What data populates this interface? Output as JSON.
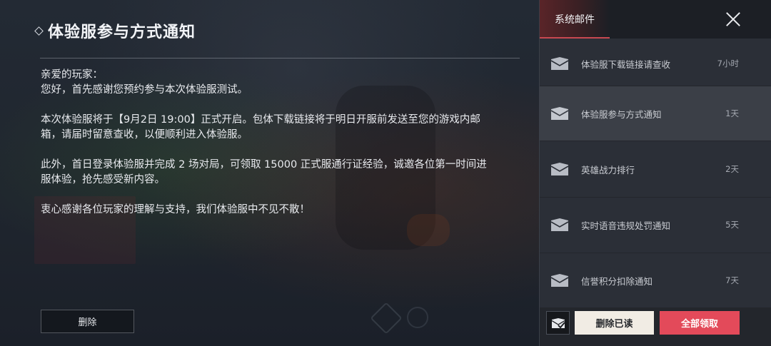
{
  "detail": {
    "title": "体验服参与方式通知",
    "greeting": "亲爱的玩家：",
    "line1": "您好，首先感谢您预约参与本次体验服测试。",
    "para2_line1": "本次体验服将于【9月2日 19:00】正式开启。包体下载链接将于明日开服前发送至您的游戏内邮",
    "para2_line2": "箱，请届时留意查收，以便顺利进入体验服。",
    "para3_line1": "此外，首日登录体验服并完成 2 场对局，可领取 15000 正式服通行证经验，诚邀各位第一时间进",
    "para3_line2": "服体验，抢先感受新内容。",
    "para4": "衷心感谢各位玩家的理解与支持，我们体验服中不见不散！",
    "delete_label": "删除"
  },
  "panel": {
    "tab_label": "系统邮件",
    "accent_color": "#c84850",
    "mails": [
      {
        "subject": "体验服下载链接请查收",
        "time": "7小时",
        "icon": "envelope-icon",
        "selected": false
      },
      {
        "subject": "体验服参与方式通知",
        "time": "1天",
        "icon": "envelope-icon",
        "selected": true
      },
      {
        "subject": "英雄战力排行",
        "time": "2天",
        "icon": "envelope-icon",
        "selected": false
      },
      {
        "subject": "实时语音违规处罚通知",
        "time": "5天",
        "icon": "envelope-icon",
        "selected": false
      },
      {
        "subject": "信誉积分扣除通知",
        "time": "7天",
        "icon": "envelope-icon",
        "selected": false
      }
    ],
    "footer": {
      "read_all_icon": "mark-all-read-icon",
      "delete_read_label": "删除已读",
      "claim_all_label": "全部领取",
      "claim_all_color": "#e34a5a"
    }
  }
}
